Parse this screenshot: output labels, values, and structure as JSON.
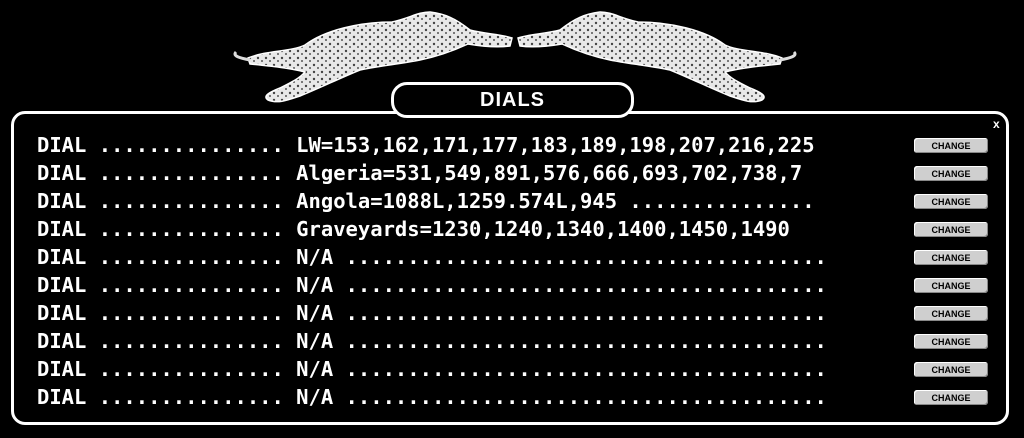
{
  "title": "DIALS",
  "close_label": "x",
  "rows": [
    {
      "text": "DIAL ............... LW=153,162,171,177,183,189,198,207,216,225",
      "button": "CHANGE"
    },
    {
      "text": "DIAL ............... Algeria=531,549,891,576,666,693,702,738,7",
      "button": "CHANGE"
    },
    {
      "text": "DIAL ............... Angola=1088L,1259.574L,945 ...............",
      "button": "CHANGE"
    },
    {
      "text": "DIAL ............... Graveyards=1230,1240,1340,1400,1450,1490",
      "button": "CHANGE"
    },
    {
      "text": "DIAL ............... N/A .......................................",
      "button": "CHANGE"
    },
    {
      "text": "DIAL ............... N/A .......................................",
      "button": "CHANGE"
    },
    {
      "text": "DIAL ............... N/A .......................................",
      "button": "CHANGE"
    },
    {
      "text": "DIAL ............... N/A .......................................",
      "button": "CHANGE"
    },
    {
      "text": "DIAL ............... N/A .......................................",
      "button": "CHANGE"
    },
    {
      "text": "DIAL ............... N/A .......................................",
      "button": "CHANGE"
    }
  ]
}
